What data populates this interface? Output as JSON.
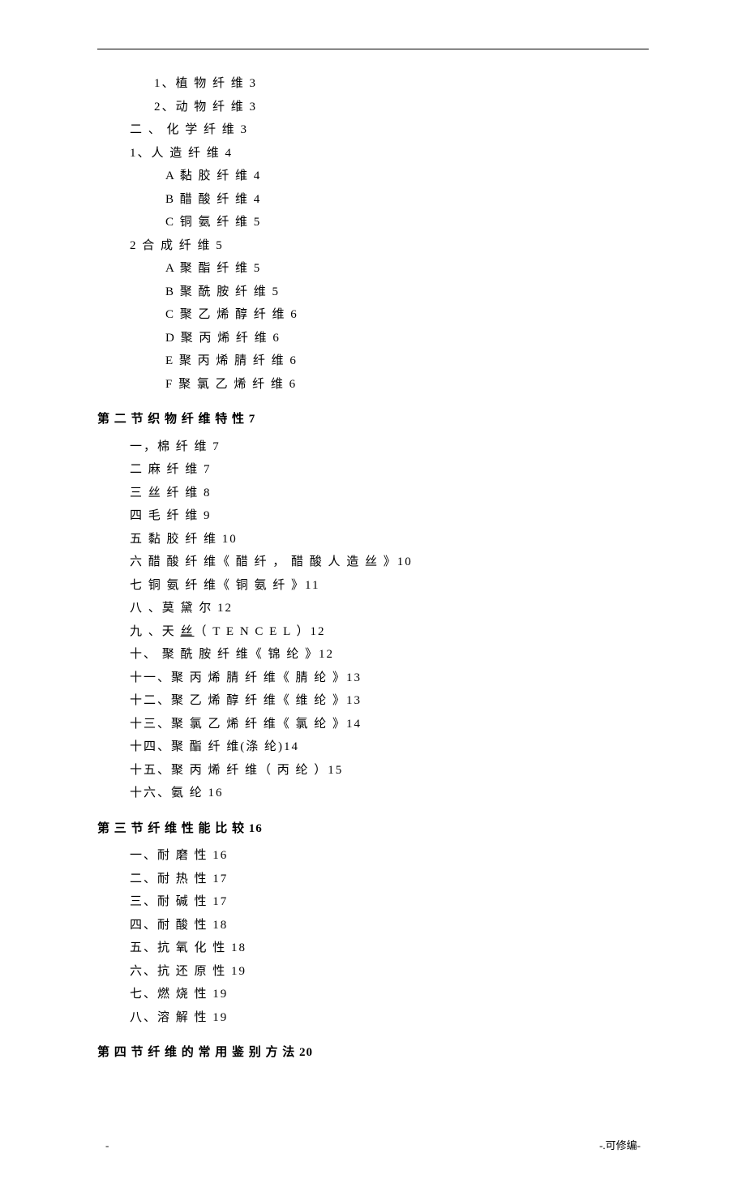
{
  "toc": {
    "section1_items": [
      {
        "text": "1、植 物 纤 维 3",
        "cls": "level-2"
      },
      {
        "text": "2、动 物 纤 维 3",
        "cls": "level-2"
      },
      {
        "text": "二 、 化 学 纤 维 3",
        "cls": "level-1"
      },
      {
        "text": "1、人 造 纤 维 4",
        "cls": "level-1"
      },
      {
        "text": "A  黏 胶 纤 维 4",
        "cls": "level-3"
      },
      {
        "text": "B  醋 酸 纤 维 4",
        "cls": "level-3"
      },
      {
        "text": "C  铜 氨 纤 维 5",
        "cls": "level-3"
      },
      {
        "text": "2  合 成 纤 维 5",
        "cls": "level-1"
      },
      {
        "text": "A  聚 酯 纤 维 5",
        "cls": "level-3"
      },
      {
        "text": "B  聚 酰 胺 纤 维 5",
        "cls": "level-3"
      },
      {
        "text": "C  聚 乙 烯 醇 纤 维 6",
        "cls": "level-3"
      },
      {
        "text": "D  聚 丙 烯 纤 维 6",
        "cls": "level-3"
      },
      {
        "text": "E  聚 丙 烯 腈 纤 维 6",
        "cls": "level-3"
      },
      {
        "text": "F  聚 氯 乙 烯 纤 维 6",
        "cls": "level-3"
      }
    ],
    "section2_heading": "第 二 节   织 物 纤 维 特 性 7",
    "section2_items": [
      {
        "text": "一，棉 纤 维 7",
        "cls": "level-1"
      },
      {
        "text": "二 麻 纤 维 7",
        "cls": "level-1"
      },
      {
        "text": "三 丝 纤 维 8",
        "cls": "level-1"
      },
      {
        "text": "四 毛 纤 维 9",
        "cls": "level-1"
      },
      {
        "text": "五 黏 胶 纤 维 10",
        "cls": "level-1"
      },
      {
        "text": "六 醋 酸 纤 维《 醋 纤 ， 醋 酸 人 造 丝 》10",
        "cls": "level-1"
      },
      {
        "text": "七 铜 氨 纤 维《 铜 氨 纤 》11",
        "cls": "level-1"
      },
      {
        "text": "八 、莫 黛 尔 12",
        "cls": "level-1"
      },
      {
        "text_pre": "九 、天 ",
        "text_underline": "丝",
        "text_post": "（ T E N C E L  ）12",
        "cls": "level-1"
      },
      {
        "text": "十、 聚 酰 胺 纤 维《 锦 纶 》12",
        "cls": "level-1"
      },
      {
        "text": "十一、聚 丙 烯 腈 纤 维《 腈 纶 》13",
        "cls": "level-1"
      },
      {
        "text": "十二、聚 乙 烯 醇 纤 维《 维 纶 》13",
        "cls": "level-1"
      },
      {
        "text": "十三、聚 氯 乙 烯 纤 维《 氯 纶 》14",
        "cls": "level-1"
      },
      {
        "text": "十四、聚 酯 纤 维(涤 纶)14",
        "cls": "level-1"
      },
      {
        "text": "十五、聚 丙 烯 纤 维（ 丙 纶 ）15",
        "cls": "level-1"
      },
      {
        "text": "十六、氨 纶 16",
        "cls": "level-1"
      }
    ],
    "section3_heading": "第 三 节 纤 维 性 能 比 较 16",
    "section3_items": [
      {
        "text": "一、耐 磨 性 16",
        "cls": "level-1"
      },
      {
        "text": "二、耐 热 性 17",
        "cls": "level-1"
      },
      {
        "text": "三、耐 碱 性 17",
        "cls": "level-1"
      },
      {
        "text": "四、耐 酸 性 18",
        "cls": "level-1"
      },
      {
        "text": "五、抗 氧 化 性 18",
        "cls": "level-1"
      },
      {
        "text": "六、抗 还 原 性 19",
        "cls": "level-1"
      },
      {
        "text": "七、燃 烧 性 19",
        "cls": "level-1"
      },
      {
        "text": "八、溶 解 性 19",
        "cls": "level-1"
      }
    ],
    "section4_heading": "第 四 节 纤 维 的 常 用 鉴 别 方 法 20"
  },
  "footer": {
    "left": "-",
    "right": "-.可修编-"
  }
}
